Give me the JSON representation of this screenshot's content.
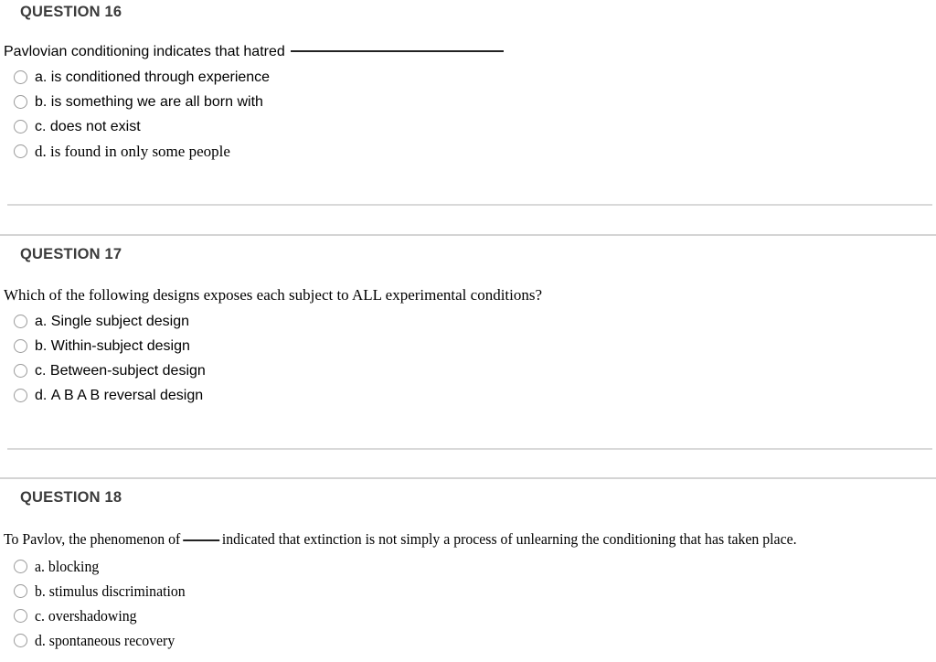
{
  "page": {
    "background_color": "#ffffff",
    "heading_color": "#3b3b3b",
    "text_color": "#000000",
    "divider_color": "#d9d9d9",
    "radio_border_color": "#9a9a9a"
  },
  "questions": [
    {
      "heading": "QUESTION 16",
      "stem_prefix": "Pavlovian conditioning indicates that hatred",
      "stem_suffix": "",
      "has_long_blank": true,
      "has_inline_blank": false,
      "stem_font": "sans",
      "options": [
        {
          "letter": "a.",
          "text": "is conditioned through experience",
          "font": "sans"
        },
        {
          "letter": "b.",
          "text": "is something we are all born with",
          "font": "sans"
        },
        {
          "letter": "c.",
          "text": "does not exist",
          "font": "sans"
        },
        {
          "letter": "d.",
          "text": "is found in only some people",
          "font": "serif"
        }
      ]
    },
    {
      "heading": "QUESTION 17",
      "stem_prefix": "Which of the following designs exposes each subject to ALL experimental conditions?",
      "stem_suffix": "",
      "has_long_blank": false,
      "has_inline_blank": false,
      "stem_font": "serif",
      "options": [
        {
          "letter": "a.",
          "text": "Single subject design",
          "font": "sans"
        },
        {
          "letter": "b.",
          "text": "Within-subject design",
          "font": "sans"
        },
        {
          "letter": "c.",
          "text": "Between-subject design",
          "font": "sans"
        },
        {
          "letter": "d.",
          "text": "A B A B reversal design",
          "font": "sans"
        }
      ]
    },
    {
      "heading": "QUESTION 18",
      "stem_prefix": "To Pavlov, the phenomenon of",
      "stem_suffix": "indicated that extinction is not simply a process of unlearning the conditioning that has taken place.",
      "has_long_blank": false,
      "has_inline_blank": true,
      "stem_font": "serif-narrow",
      "options": [
        {
          "letter": "a.",
          "text": "blocking",
          "font": "serif-narrow"
        },
        {
          "letter": "b.",
          "text": "stimulus discrimination",
          "font": "serif-narrow"
        },
        {
          "letter": "c.",
          "text": "overshadowing",
          "font": "serif-narrow"
        },
        {
          "letter": "d.",
          "text": "spontaneous recovery",
          "font": "serif-narrow"
        }
      ]
    }
  ]
}
